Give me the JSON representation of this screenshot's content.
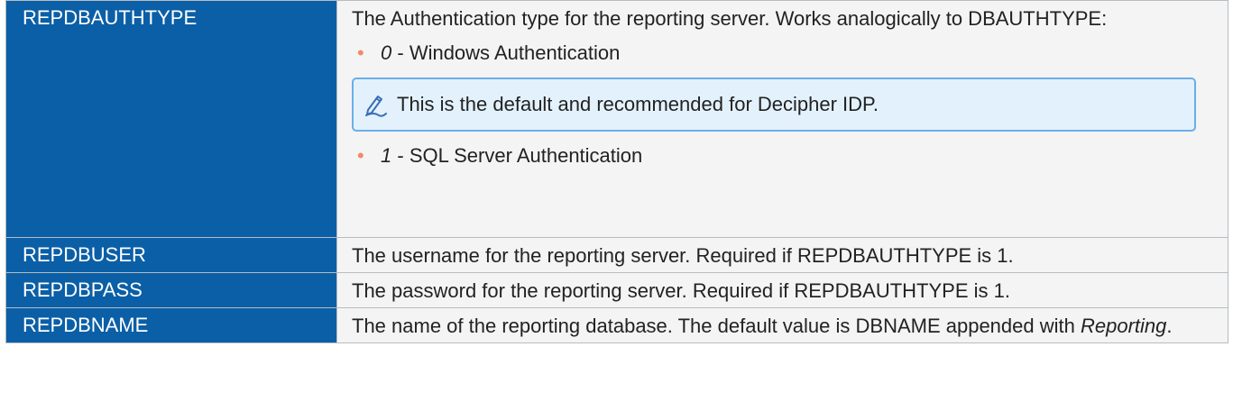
{
  "rows": [
    {
      "key": "REPDBAUTHTYPE",
      "desc": "The Authentication type for the reporting server. Works analogically to DBAUTHTYPE:",
      "options": [
        {
          "num": "0",
          "sep": " - ",
          "label": "Windows Authentication"
        },
        {
          "num": "1",
          "sep": " - ",
          "label": "SQL Server Authentication"
        }
      ],
      "note": "This is the default and recommended for Decipher IDP."
    },
    {
      "key": "REPDBUSER",
      "desc": "The username for the reporting server. Required if REPDBAUTHTYPE is 1."
    },
    {
      "key": "REPDBPASS",
      "desc": "The password for the reporting server. Required if REPDBAUTHTYPE is 1."
    },
    {
      "key": "REPDBNAME",
      "desc": "The name of the reporting database. The default value is DBNAME appended with ",
      "desc_italic": "Reporting",
      "desc_end": "."
    }
  ],
  "colors": {
    "key_bg": "#0b5fa6",
    "desc_bg": "#f4f4f4",
    "bullet": "#f08a6b",
    "note_bg": "#e3f1fc",
    "note_border": "#6aaee8"
  },
  "icons": {
    "note": "pencil-icon"
  }
}
